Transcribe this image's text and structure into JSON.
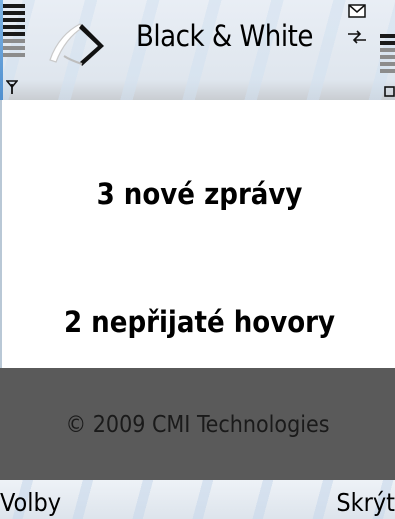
{
  "titlebar": {
    "title": "Black & White",
    "icons": [
      "signal-strength-icon",
      "antenna-icon",
      "app-logo",
      "new-message-icon",
      "data-transfer-icon",
      "battery-icon",
      "keypad-lock-icon"
    ]
  },
  "notifications": {
    "messages": "3 nové zprávy",
    "missed_calls": "2 nepřijaté hovory"
  },
  "footer": {
    "copyright": "© 2009 CMI Technologies"
  },
  "softkeys": {
    "left": "Volby",
    "right": "Skrýt"
  },
  "colors": {
    "background": "#ffffff",
    "footer_band": "#5a5a5a",
    "accent_blue": "#4f8fcf"
  }
}
